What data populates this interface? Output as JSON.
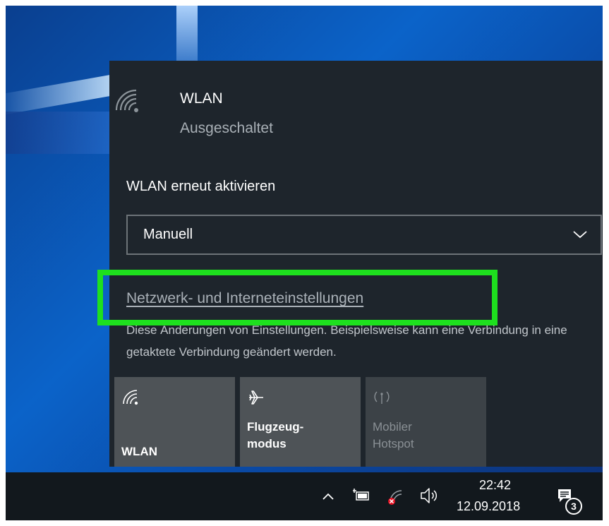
{
  "flyout": {
    "wlan_title": "WLAN",
    "wlan_status": "Ausgeschaltet",
    "reactivate_label": "WLAN erneut aktivieren",
    "reactivate_value": "Manuell",
    "settings_link": "Netzwerk- und Interneteinstellungen",
    "description": "Diese Änderungen von Einstellungen. Beispielsweise kann eine Verbindung in eine getaktete Verbindung geändert werden.",
    "highlight_color": "#1ee01e"
  },
  "quick_actions": [
    {
      "label": "WLAN",
      "icon": "wifi-icon",
      "enabled": true
    },
    {
      "label": "Flugzeug-\nmodus",
      "icon": "airplane-icon",
      "enabled": true
    },
    {
      "label": "Mobiler\nHotspot",
      "icon": "hotspot-icon",
      "enabled": false
    }
  ],
  "taskbar": {
    "time": "22:42",
    "date": "12.09.2018",
    "notification_count": "3",
    "tray_icons": [
      "chevron-up-icon",
      "battery-plug-icon",
      "network-disconnected-icon",
      "speaker-icon"
    ]
  },
  "colors": {
    "flyout_bg": "#1e252c",
    "tile_bg": "#4e5357",
    "tile_disabled_bg": "#3c4247",
    "taskbar_bg": "#12181d"
  }
}
